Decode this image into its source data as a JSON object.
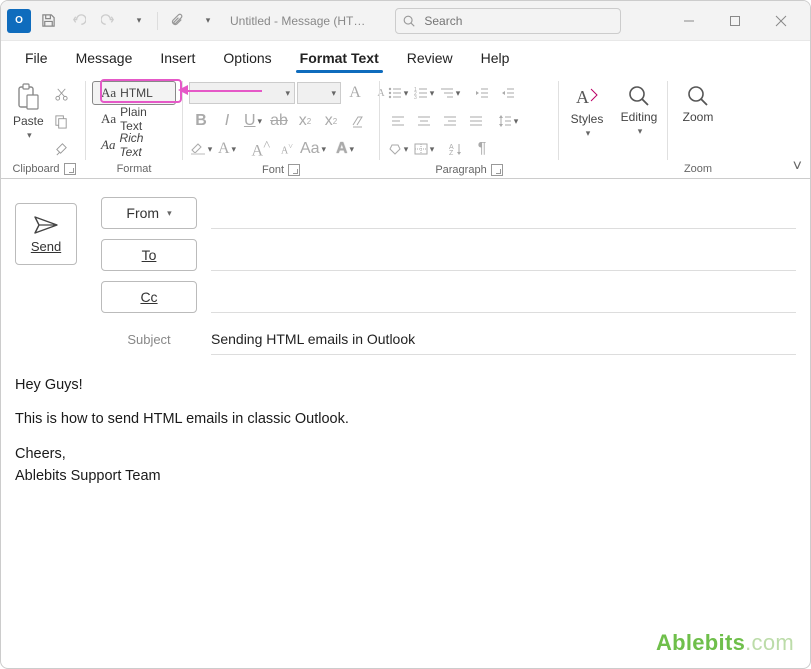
{
  "titlebar": {
    "app_icon_text": "O",
    "title": "Untitled - Message (HT…",
    "search_placeholder": "Search"
  },
  "menu": {
    "file": "File",
    "message": "Message",
    "insert": "Insert",
    "options": "Options",
    "format_text": "Format Text",
    "review": "Review",
    "help": "Help"
  },
  "ribbon": {
    "clipboard": {
      "paste": "Paste",
      "group": "Clipboard"
    },
    "format": {
      "html": "HTML",
      "plain": "Plain Text",
      "rich": "Rich Text",
      "aa": "Aa",
      "group": "Format"
    },
    "font": {
      "group": "Font"
    },
    "paragraph": {
      "group": "Paragraph"
    },
    "styles": {
      "label": "Styles"
    },
    "editing": {
      "label": "Editing"
    },
    "zoom": {
      "label": "Zoom",
      "group": "Zoom"
    }
  },
  "compose": {
    "send": "Send",
    "from": "From",
    "to": "To",
    "cc": "Cc",
    "subject_label": "Subject",
    "subject_value": "Sending HTML emails in Outlook",
    "body": {
      "l1": "Hey Guys!",
      "l2": "This is how to send HTML emails in classic Outlook.",
      "l3": "Cheers,",
      "l4": "Ablebits Support Team"
    }
  },
  "watermark": {
    "brand": "Ablebits",
    "domain": ".com"
  }
}
